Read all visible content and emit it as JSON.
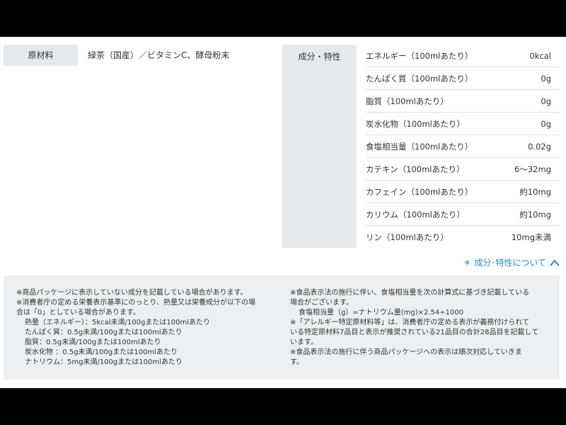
{
  "raw_materials": {
    "label": "原材料",
    "value": "緑茶（国産）／ビタミンC、酵母粉末"
  },
  "components": {
    "label": "成分・特性",
    "rows": [
      {
        "name": "エネルギー（100mlあたり）",
        "value": "0kcal"
      },
      {
        "name": "たんぱく質（100mlあたり）",
        "value": "0g"
      },
      {
        "name": "脂質（100mlあたり）",
        "value": "0g"
      },
      {
        "name": "炭水化物（100mlあたり）",
        "value": "0g"
      },
      {
        "name": "食塩相当量（100mlあたり）",
        "value": "0.02g"
      },
      {
        "name": "カテキン（100mlあたり）",
        "value": "6〜32mg"
      },
      {
        "name": "カフェイン（100mlあたり）",
        "value": "約10mg"
      },
      {
        "name": "カリウム（100mlあたり）",
        "value": "約10mg"
      },
      {
        "name": "リン（100mlあたり）",
        "value": "10mg未満"
      }
    ]
  },
  "toggle": {
    "asterisk": "＊",
    "label": "成分･特性について",
    "icon": "chevron-up-icon"
  },
  "notes": {
    "left": [
      "※商品パッケージに表示していない成分を記載している場合があります。",
      "※消費者庁の定める栄養表示基準にのっとり、熱量又は栄養成分が以下の場",
      "合は「0」としている場合があります。",
      "熱量（エネルギー）：5kcal未満/100gまたは100mlあたり",
      "たんぱく質：0.5g未満/100gまたは100mlあたり",
      "脂質：0.5g未満/100gまたは100mlあたり",
      "炭水化物 ：0.5g未満/100gまたは100mlあたり",
      "ナトリウム：5mg未満/100gまたは100mlあたり"
    ],
    "right": [
      "※食品表示法の施行に伴い、食塩相当量を次の計算式に基づき記載している",
      "場合がございます。",
      "食塩相当量（g）=ナトリウム量(mg)×2.54÷1000",
      "※「アレルギー特定原材料等」は、消費者庁の定める表示が義務付けられて",
      "いる特定原材料7品目と表示が推奨されている21品目の合計28品目を記載して",
      "います。",
      "※食品表示法の施行に伴う商品パッケージへの表示は順次対応していきま",
      "す。"
    ]
  },
  "colors": {
    "accent": "#2a8fbd",
    "label_bg": "#e5e9ec",
    "notes_bg": "#edf0f2"
  }
}
